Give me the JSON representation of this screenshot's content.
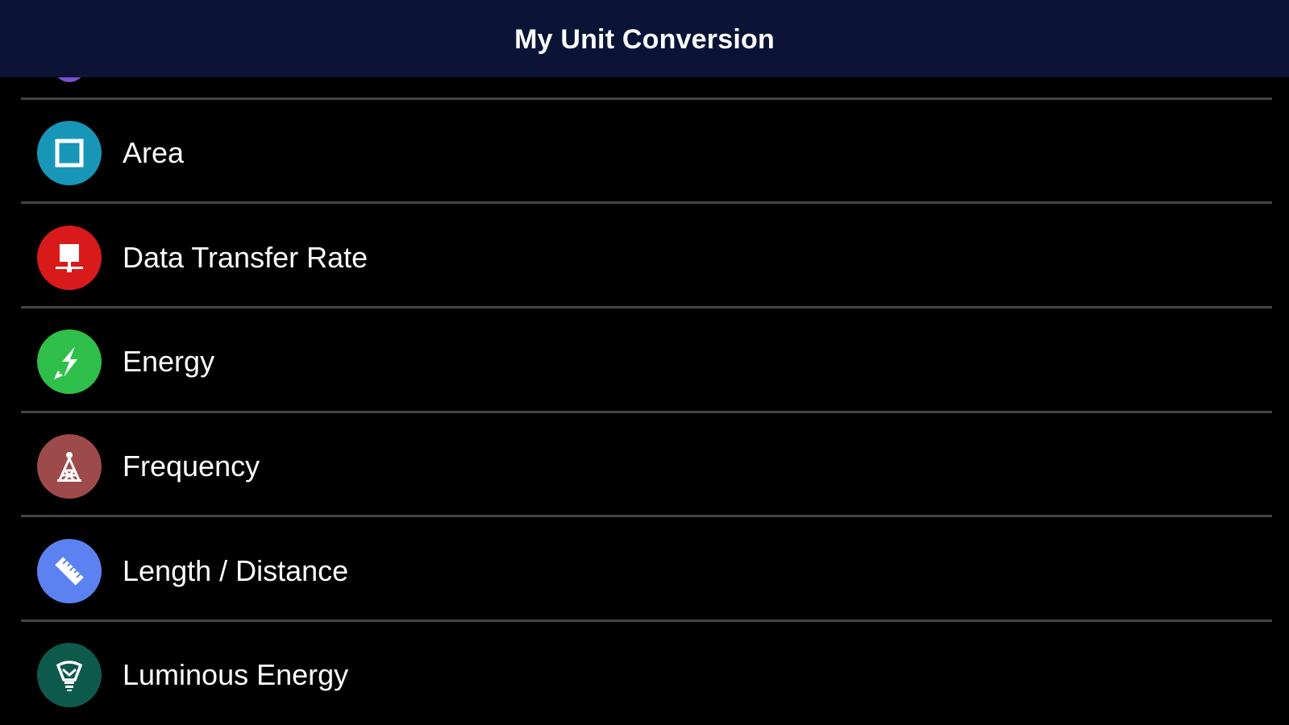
{
  "header": {
    "title": "My Unit Conversion",
    "background": "#0b1436"
  },
  "categories": [
    {
      "label": "Area",
      "icon": "square-icon",
      "color": "#1896b8"
    },
    {
      "label": "Data Transfer Rate",
      "icon": "monitor-icon",
      "color": "#d91a1a"
    },
    {
      "label": "Energy",
      "icon": "lightning-icon",
      "color": "#2fbf4a"
    },
    {
      "label": "Frequency",
      "icon": "radio-tower-icon",
      "color": "#9e4a4a"
    },
    {
      "label": "Length / Distance",
      "icon": "ruler-icon",
      "color": "#5b82f0"
    },
    {
      "label": "Luminous Energy",
      "icon": "light-bulb-icon",
      "color": "#0d5a4c"
    }
  ],
  "partial_item": {
    "icon": "partial-category-icon",
    "color": "#7d4fd1"
  }
}
